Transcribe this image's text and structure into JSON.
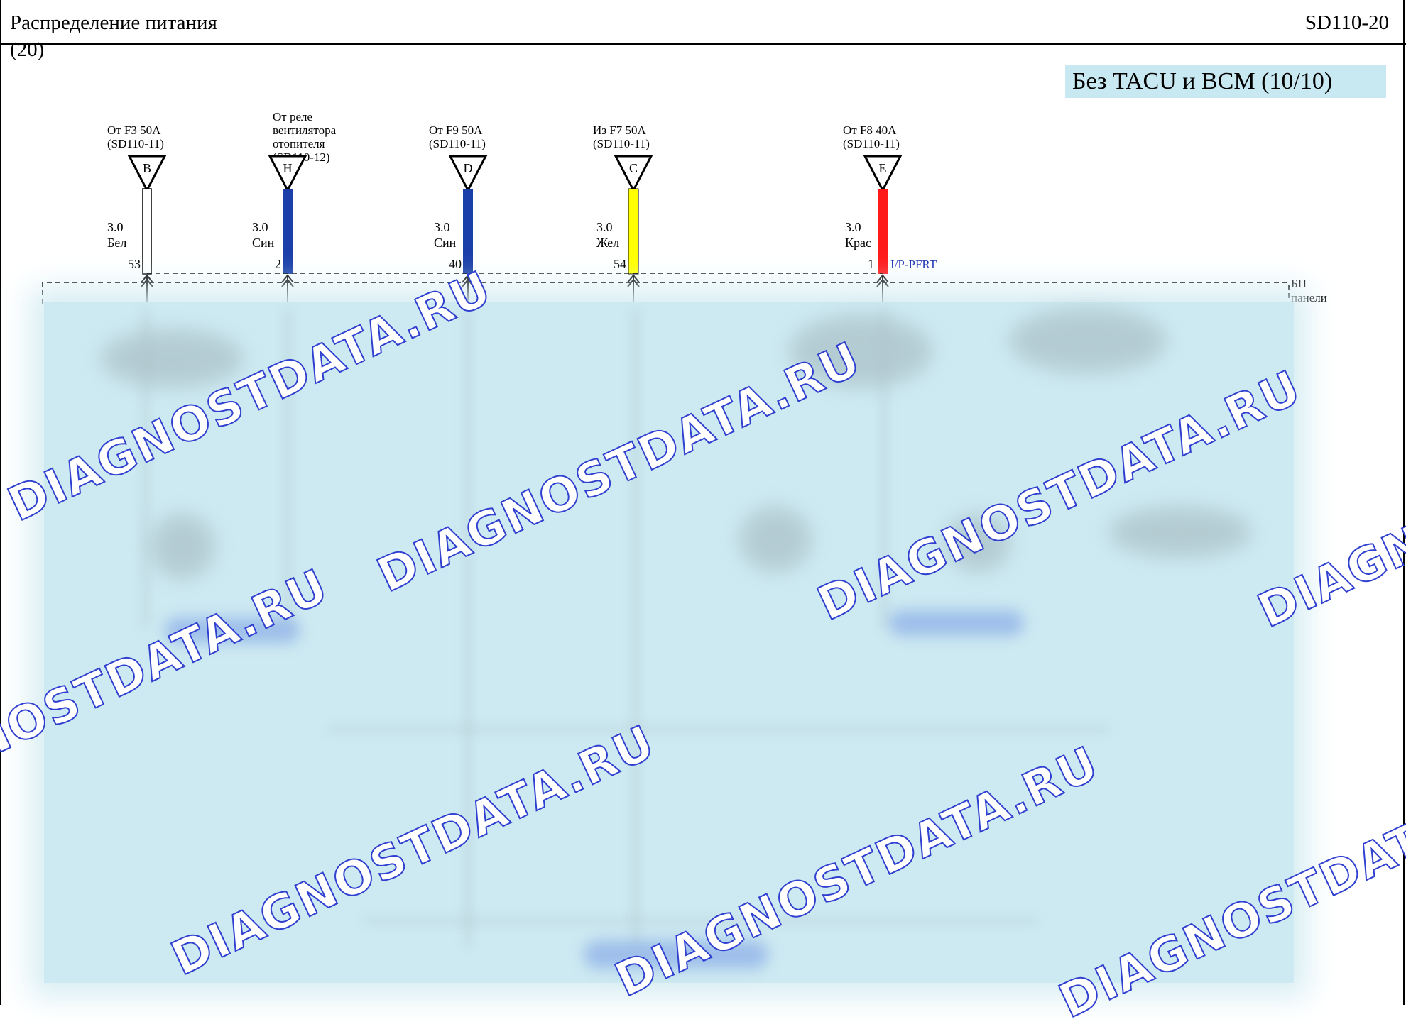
{
  "header": {
    "title": "Распределение питания",
    "subtitle": "(20)",
    "code": "SD110-20"
  },
  "badge": "Без TACU и BCM (10/10)",
  "connector": {
    "name": "I/P-PFRT",
    "block_label_line1": "БП",
    "block_label_line2": "панели"
  },
  "wires": [
    {
      "src_lines": [
        "От F3 50A",
        "(SD110-11)"
      ],
      "letter": "B",
      "size": "3.0",
      "color_name": "Бел",
      "pin": "53",
      "color": "#ffffff"
    },
    {
      "src_lines": [
        "От реле",
        "вентилятора",
        "отопителя",
        "(SD110-12)"
      ],
      "letter": "H",
      "size": "3.0",
      "color_name": "Син",
      "pin": "2",
      "color": "#1b3fa8"
    },
    {
      "src_lines": [
        "От F9 50A",
        "(SD110-11)"
      ],
      "letter": "D",
      "size": "3.0",
      "color_name": "Син",
      "pin": "40",
      "color": "#1b3fa8"
    },
    {
      "src_lines": [
        "Из F7 50A",
        "(SD110-11)"
      ],
      "letter": "C",
      "size": "3.0",
      "color_name": "Жел",
      "pin": "54",
      "color": "#ffff00"
    },
    {
      "src_lines": [
        "От F8 40A",
        "(SD110-11)"
      ],
      "letter": "E",
      "size": "3.0",
      "color_name": "Крас",
      "pin": "1",
      "color": "#ff1a1a"
    }
  ],
  "watermark": "DIAGNOSTDATA.RU"
}
